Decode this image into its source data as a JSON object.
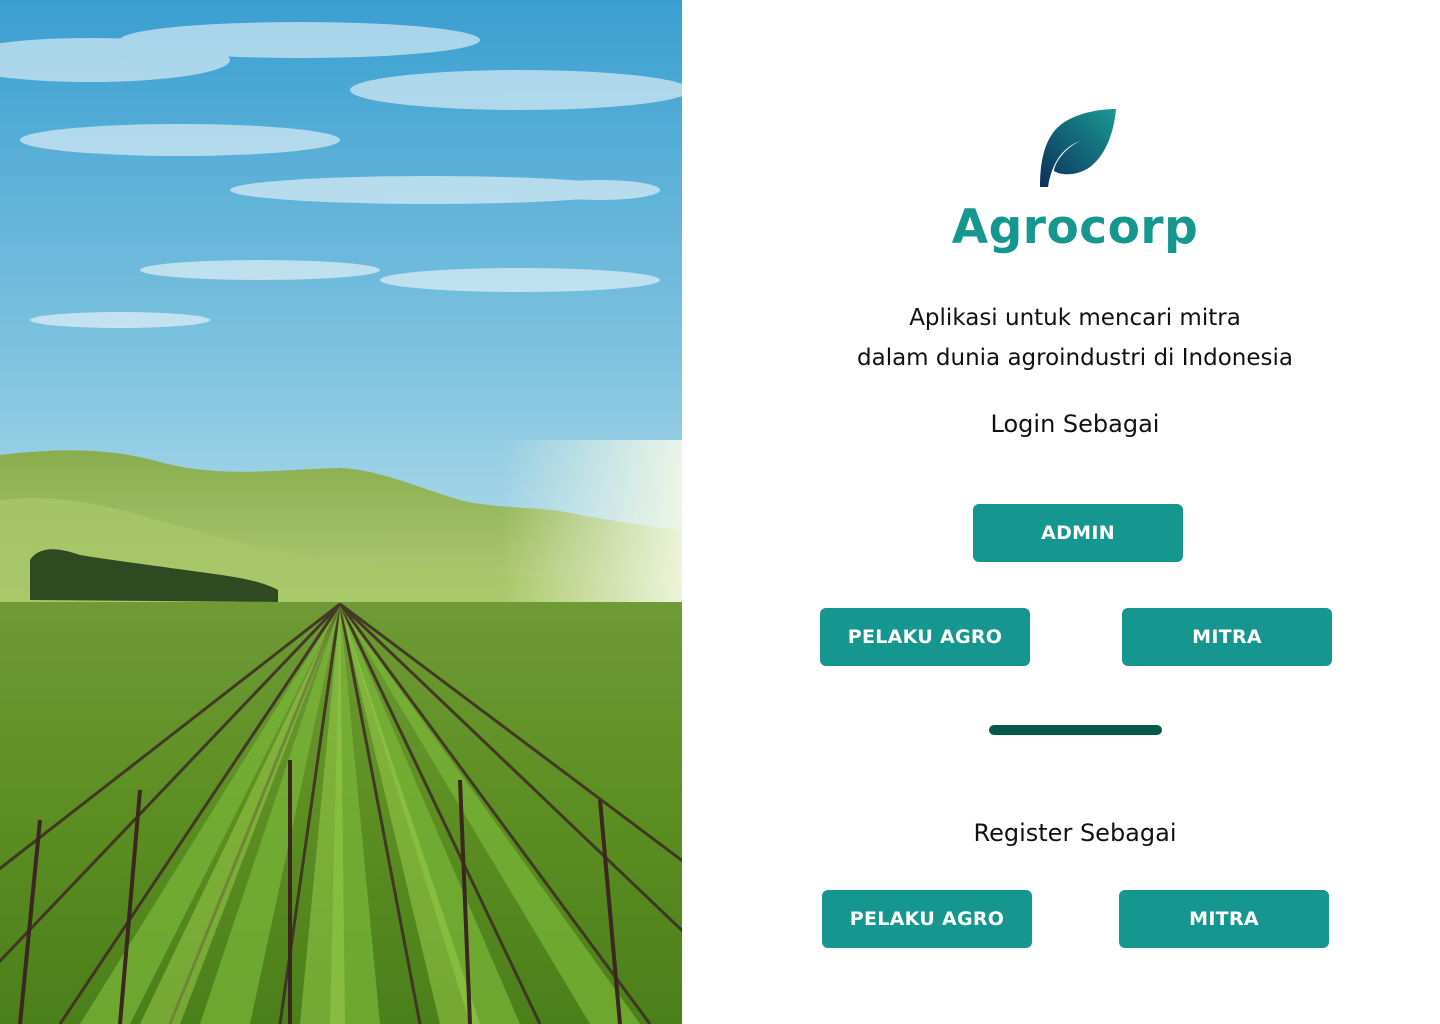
{
  "brand": {
    "name": "Agrocorp",
    "icon": "leaf-icon",
    "color": "#15968f"
  },
  "tagline": {
    "line1": "Aplikasi untuk mencari mitra",
    "line2": "dalam dunia agroindustri di Indonesia"
  },
  "login": {
    "label": "Login Sebagai",
    "buttons": {
      "admin": "ADMIN",
      "pelaku_agro": "PELAKU AGRO",
      "mitra": "MITRA"
    }
  },
  "register": {
    "label": "Register Sebagai",
    "buttons": {
      "pelaku_agro": "PELAKU AGRO",
      "mitra": "MITRA"
    }
  },
  "hero": {
    "image": "vineyard-landscape-photo"
  },
  "colors": {
    "button": "#15968f",
    "divider": "#075a49",
    "text": "#111111"
  }
}
